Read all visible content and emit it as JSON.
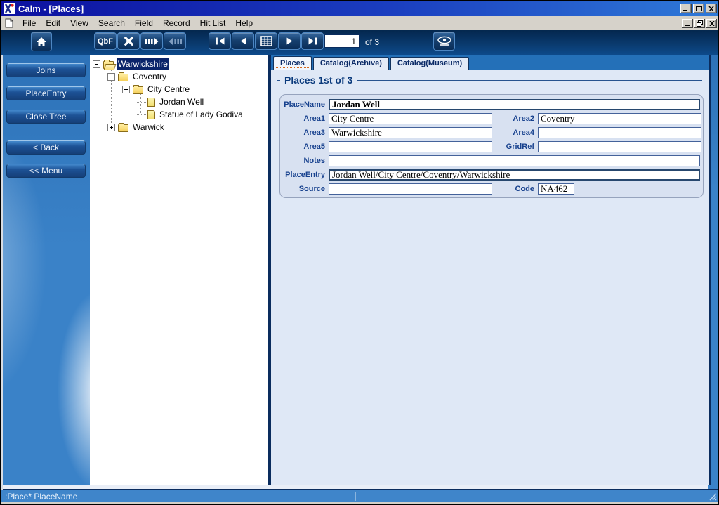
{
  "window": {
    "title": "Calm - [Places]",
    "controls": [
      "minimize",
      "maximize",
      "close"
    ],
    "child_controls": [
      "minimize",
      "restore",
      "close"
    ]
  },
  "menu": {
    "items": [
      {
        "label": "File",
        "accel": 0
      },
      {
        "label": "Edit",
        "accel": 0
      },
      {
        "label": "View",
        "accel": 0
      },
      {
        "label": "Search",
        "accel": 0
      },
      {
        "label": "Field",
        "accel": 4
      },
      {
        "label": "Record",
        "accel": 0
      },
      {
        "label": "Hit List",
        "accel": 4
      },
      {
        "label": "Help",
        "accel": 0
      }
    ]
  },
  "toolbar": {
    "qbf_label": "QbF",
    "record_number": "1",
    "record_count_label": "of 3",
    "icons": [
      "home-icon",
      "expand-icon",
      "fast-forward-icon",
      "fast-rewind-icon",
      "first-record-icon",
      "previous-record-icon",
      "hit-list-grid-icon",
      "next-record-icon",
      "last-record-icon",
      "eye-view-icon"
    ]
  },
  "sidebar": {
    "buttons": [
      "Joins",
      "PlaceEntry",
      "Close Tree",
      "< Back",
      "<< Menu"
    ]
  },
  "tree": {
    "items": [
      {
        "label": "Warwickshire",
        "level": 0,
        "expander": "minus",
        "icon": "folder-open",
        "selected": true
      },
      {
        "label": "Coventry",
        "level": 1,
        "expander": "minus",
        "icon": "folder",
        "selected": false
      },
      {
        "label": "City Centre",
        "level": 2,
        "expander": "minus",
        "icon": "folder",
        "selected": false
      },
      {
        "label": "Jordan Well",
        "level": 3,
        "expander": "none",
        "icon": "page",
        "selected": false
      },
      {
        "label": "Statue of Lady Godiva",
        "level": 3,
        "expander": "none",
        "icon": "page",
        "selected": false
      },
      {
        "label": "Warwick",
        "level": 1,
        "expander": "plus",
        "icon": "folder",
        "selected": false
      }
    ]
  },
  "tabs": [
    {
      "label": "Places",
      "active": true
    },
    {
      "label": "Catalog(Archive)",
      "active": false
    },
    {
      "label": "Catalog(Museum)",
      "active": false
    }
  ],
  "main": {
    "group_title": "Places 1st of 3",
    "fields": {
      "placename": {
        "label": "PlaceName",
        "value": "Jordan Well"
      },
      "area1": {
        "label": "Area1",
        "value": "City Centre"
      },
      "area2": {
        "label": "Area2",
        "value": "Coventry"
      },
      "area3": {
        "label": "Area3",
        "value": "Warwickshire"
      },
      "area4": {
        "label": "Area4",
        "value": ""
      },
      "area5": {
        "label": "Area5",
        "value": ""
      },
      "gridref": {
        "label": "GridRef",
        "value": ""
      },
      "notes": {
        "label": "Notes",
        "value": ""
      },
      "placeentry": {
        "label": "PlaceEntry",
        "value": "Jordan Well/City Centre/Coventry/Warwickshire"
      },
      "source": {
        "label": "Source",
        "value": ""
      },
      "code": {
        "label": "Code",
        "value": "NA462"
      }
    }
  },
  "status": {
    "left": ":Place* PlaceName",
    "right": ""
  },
  "colors": {
    "title_bar_left": "#0c10a0",
    "title_bar_right": "#2f7ad8",
    "toolbar_navy": "#0a3a6e",
    "frame_blue": "#3a82c8",
    "content_bg": "#dfe8f6",
    "panel_bg": "#d8e1f1",
    "accent_navy": "#0a2c5e",
    "selection": "#0a246a",
    "label_blue": "#17418e",
    "tab_focus_outline": "#d4691e"
  }
}
